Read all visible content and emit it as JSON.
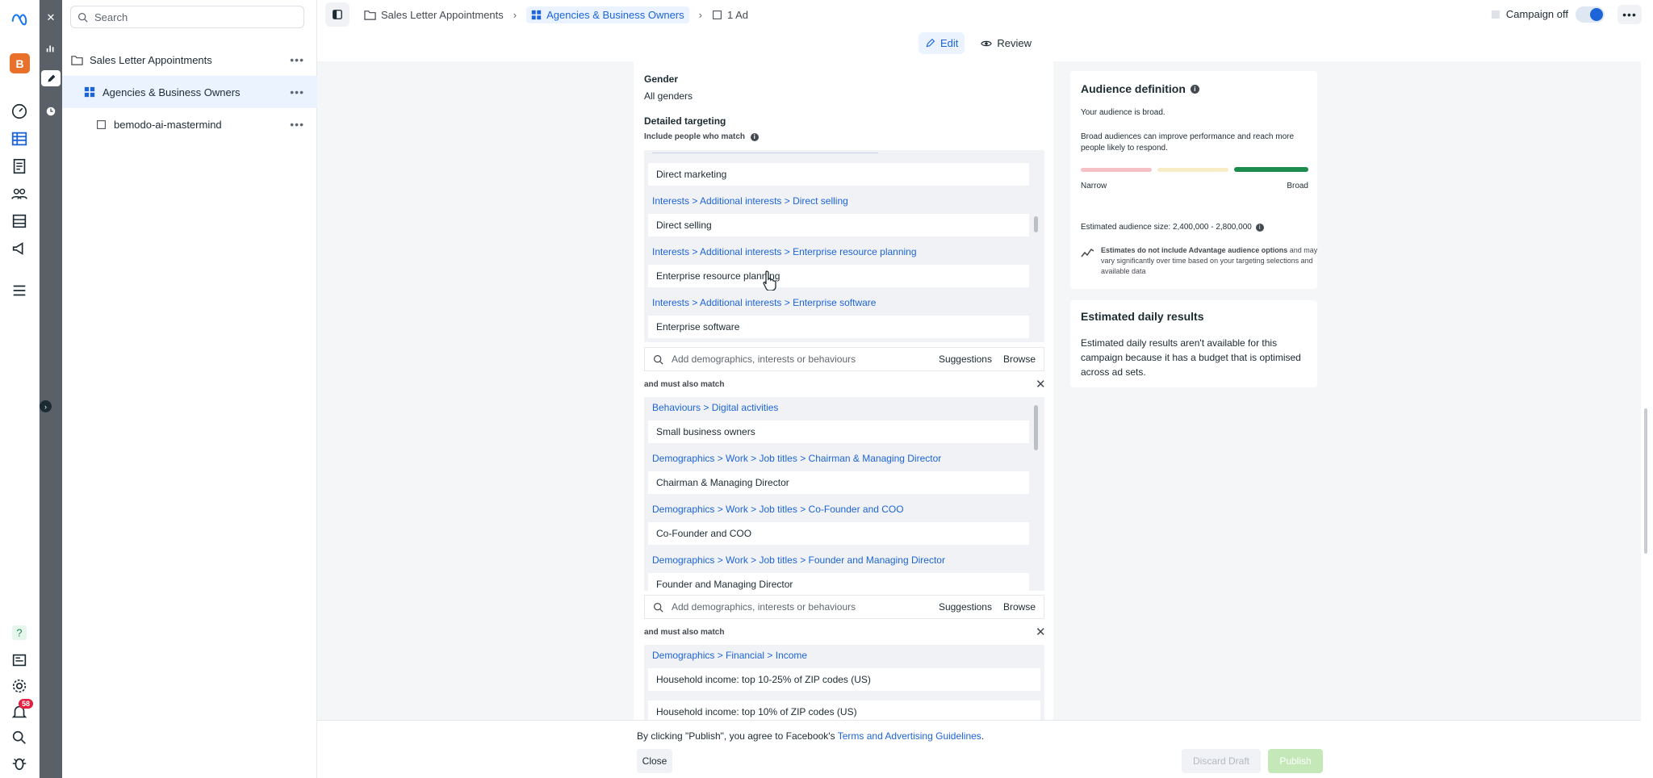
{
  "rail": {
    "avatar_letter": "B",
    "notif_count": "58"
  },
  "tree": {
    "search_placeholder": "Search",
    "items": [
      {
        "label": "Sales Letter Appointments"
      },
      {
        "label": "Agencies & Business Owners"
      },
      {
        "label": "bemodo-ai-mastermind"
      }
    ]
  },
  "breadcrumb": {
    "campaign": "Sales Letter Appointments",
    "adset": "Agencies & Business Owners",
    "ad": "1 Ad"
  },
  "header": {
    "campaign_status": "Campaign off",
    "edit_label": "Edit",
    "review_label": "Review"
  },
  "form": {
    "gender_label": "Gender",
    "gender_value": "All genders",
    "detailed_targeting_label": "Detailed targeting",
    "include_label": "Include people who match",
    "group1": [
      {
        "kind": "item",
        "text": "Direct marketing"
      },
      {
        "kind": "path",
        "text": "Interests > Additional interests > Direct selling"
      },
      {
        "kind": "item",
        "text": "Direct selling"
      },
      {
        "kind": "path",
        "text": "Interests > Additional interests > Enterprise resource planning"
      },
      {
        "kind": "item",
        "text": "Enterprise resource planning"
      },
      {
        "kind": "path",
        "text": "Interests > Additional interests > Enterprise software"
      },
      {
        "kind": "item",
        "text": "Enterprise software"
      }
    ],
    "add_placeholder": "Add demographics, interests or behaviours",
    "suggestions_label": "Suggestions",
    "browse_label": "Browse",
    "must_also_match_label": "and must also match",
    "group2": [
      {
        "kind": "path",
        "text": "Behaviours > Digital activities"
      },
      {
        "kind": "item",
        "text": "Small business owners"
      },
      {
        "kind": "path",
        "text": "Demographics > Work > Job titles > Chairman & Managing Director"
      },
      {
        "kind": "item",
        "text": "Chairman & Managing Director"
      },
      {
        "kind": "path",
        "text": "Demographics > Work > Job titles > Co-Founder and COO"
      },
      {
        "kind": "item",
        "text": "Co-Founder and COO"
      },
      {
        "kind": "path",
        "text": "Demographics > Work > Job titles > Founder and Managing Director"
      },
      {
        "kind": "item",
        "text": "Founder and Managing Director"
      }
    ],
    "group3": [
      {
        "kind": "path",
        "text": "Demographics > Financial > Income"
      },
      {
        "kind": "item",
        "text": "Household income: top 10-25% of ZIP codes (US)"
      },
      {
        "kind": "item",
        "text": "Household income: top 10% of ZIP codes (US)"
      }
    ]
  },
  "audience": {
    "title": "Audience definition",
    "broad_text": "Your audience is broad.",
    "broad_desc": "Broad audiences can improve performance and reach more people likely to respond.",
    "narrow_label": "Narrow",
    "broad_label": "Broad",
    "size_text": "Estimated audience size: 2,400,000 - 2,800,000",
    "note_bold": "Estimates do not include Advantage audience options",
    "note_rest": " and may vary significantly over time based on your targeting selections and available data",
    "gauge_level": "broad",
    "gauge_colors": [
      "#f6c1c5",
      "#f7ecc6",
      "#1d8a4e"
    ]
  },
  "daily": {
    "title": "Estimated daily results",
    "text": "Estimated daily results aren't available for this campaign because it has a budget that is optimised across ad sets."
  },
  "footer": {
    "terms_prefix": "By clicking \"Publish\", you agree to Facebook's ",
    "terms_link": "Terms and Advertising Guidelines",
    "terms_suffix": ".",
    "close_label": "Close",
    "discard_label": "Discard Draft",
    "publish_label": "Publish"
  },
  "colors": {
    "accent": "#1d64d8",
    "publish_disabled": "#c5e8b8"
  }
}
